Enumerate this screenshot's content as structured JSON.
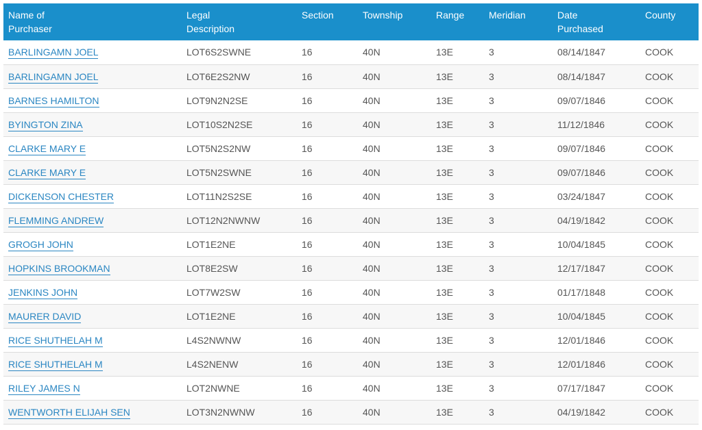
{
  "table": {
    "headers": [
      "Name of\nPurchaser",
      "Legal\nDescription",
      "Section",
      "Township",
      "Range",
      "Meridian",
      "Date\nPurchased",
      "County"
    ],
    "rows": [
      {
        "name": "BARLINGAMN JOEL",
        "legal": "LOT6S2SWNE",
        "section": "16",
        "township": "40N",
        "range": "13E",
        "meridian": "3",
        "date": "08/14/1847",
        "county": "COOK"
      },
      {
        "name": "BARLINGAMN JOEL",
        "legal": "LOT6E2S2NW",
        "section": "16",
        "township": "40N",
        "range": "13E",
        "meridian": "3",
        "date": "08/14/1847",
        "county": "COOK"
      },
      {
        "name": "BARNES HAMILTON",
        "legal": "LOT9N2N2SE",
        "section": "16",
        "township": "40N",
        "range": "13E",
        "meridian": "3",
        "date": "09/07/1846",
        "county": "COOK"
      },
      {
        "name": "BYINGTON ZINA",
        "legal": "LOT10S2N2SE",
        "section": "16",
        "township": "40N",
        "range": "13E",
        "meridian": "3",
        "date": "11/12/1846",
        "county": "COOK"
      },
      {
        "name": "CLARKE MARY E",
        "legal": "LOT5N2S2NW",
        "section": "16",
        "township": "40N",
        "range": "13E",
        "meridian": "3",
        "date": "09/07/1846",
        "county": "COOK"
      },
      {
        "name": "CLARKE MARY E",
        "legal": "LOT5N2SWNE",
        "section": "16",
        "township": "40N",
        "range": "13E",
        "meridian": "3",
        "date": "09/07/1846",
        "county": "COOK"
      },
      {
        "name": "DICKENSON CHESTER",
        "legal": "LOT11N2S2SE",
        "section": "16",
        "township": "40N",
        "range": "13E",
        "meridian": "3",
        "date": "03/24/1847",
        "county": "COOK"
      },
      {
        "name": "FLEMMING ANDREW",
        "legal": "LOT12N2NWNW",
        "section": "16",
        "township": "40N",
        "range": "13E",
        "meridian": "3",
        "date": "04/19/1842",
        "county": "COOK"
      },
      {
        "name": "GROGH JOHN",
        "legal": "LOT1E2NE",
        "section": "16",
        "township": "40N",
        "range": "13E",
        "meridian": "3",
        "date": "10/04/1845",
        "county": "COOK"
      },
      {
        "name": "HOPKINS BROOKMAN",
        "legal": "LOT8E2SW",
        "section": "16",
        "township": "40N",
        "range": "13E",
        "meridian": "3",
        "date": "12/17/1847",
        "county": "COOK"
      },
      {
        "name": "JENKINS JOHN",
        "legal": "LOT7W2SW",
        "section": "16",
        "township": "40N",
        "range": "13E",
        "meridian": "3",
        "date": "01/17/1848",
        "county": "COOK"
      },
      {
        "name": "MAURER DAVID",
        "legal": "LOT1E2NE",
        "section": "16",
        "township": "40N",
        "range": "13E",
        "meridian": "3",
        "date": "10/04/1845",
        "county": "COOK"
      },
      {
        "name": "RICE SHUTHELAH M",
        "legal": "L4S2NWNW",
        "section": "16",
        "township": "40N",
        "range": "13E",
        "meridian": "3",
        "date": "12/01/1846",
        "county": "COOK"
      },
      {
        "name": "RICE SHUTHELAH M",
        "legal": "L4S2NENW",
        "section": "16",
        "township": "40N",
        "range": "13E",
        "meridian": "3",
        "date": "12/01/1846",
        "county": "COOK"
      },
      {
        "name": "RILEY JAMES N",
        "legal": "LOT2NWNE",
        "section": "16",
        "township": "40N",
        "range": "13E",
        "meridian": "3",
        "date": "07/17/1847",
        "county": "COOK"
      },
      {
        "name": "WENTWORTH ELIJAH SEN",
        "legal": "LOT3N2NWNW",
        "section": "16",
        "township": "40N",
        "range": "13E",
        "meridian": "3",
        "date": "04/19/1842",
        "county": "COOK"
      }
    ]
  },
  "colors": {
    "header_bg": "#1a8fcb",
    "link": "#2a86c2"
  }
}
